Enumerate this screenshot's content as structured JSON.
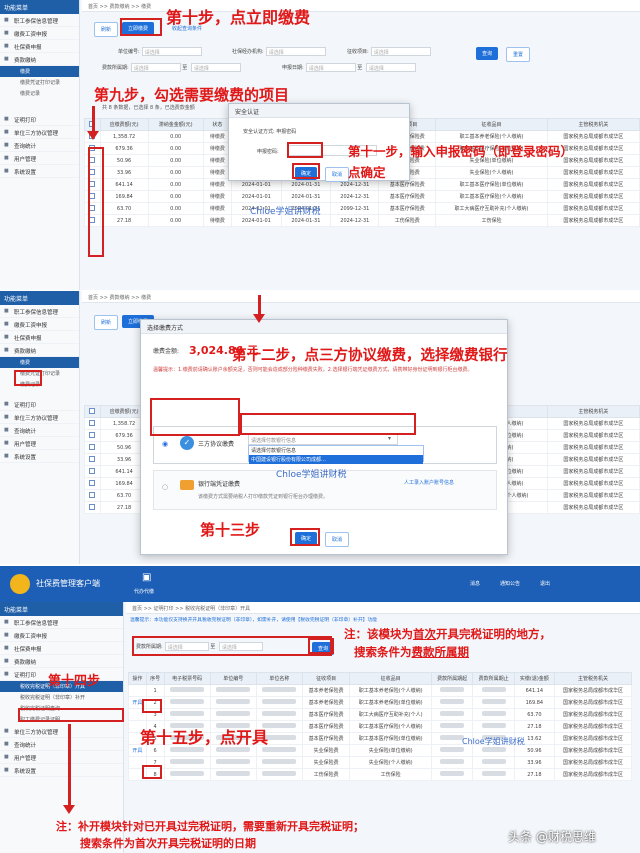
{
  "sidebar": {
    "header": "功能菜单",
    "p1_items": [
      "职工参保信息管理",
      "缴费工资申报",
      "社保费申报",
      "费款缴纳"
    ],
    "p1_sub": [
      "缴费",
      "缴费凭证打印记录",
      "缴费记录"
    ],
    "p1_items2": [
      "证明打印",
      "单位三方协议管理",
      "查询统计",
      "用户管理",
      "系统设置"
    ],
    "p3_sub": [
      "税收完税证明（非印章）开具",
      "税收完税证明（非印章）补开",
      "税收完税证明查询",
      "职工缴费记录证明"
    ]
  },
  "crumb": {
    "p1": "首页 >> 费款缴纳 >> 缴费",
    "p3": "首页 >> 证明打印 >> 税收完税证明（非印章）开具"
  },
  "toolbar": {
    "refresh": "刷新",
    "pay_now": "立即缴费",
    "collect_remind": "收起查询条件",
    "query": "查询",
    "reset": "重置"
  },
  "filters": {
    "unit_no": "单位编号:",
    "agency": "社保经办机构:",
    "collect_item": "征收项目:",
    "period": "费款所属期:",
    "to": "至",
    "pay_date": "申报日期:",
    "placeholder": "请选择"
  },
  "summary": "共 8 条数据，已选择 8 条，已选费款金额",
  "table1": {
    "headers": [
      "",
      "应缴费额(元)",
      "滞纳金金额(元)",
      "状态",
      "费款所属期起",
      "费款所属期止",
      "缴款期限",
      "征收项目",
      "征收品目",
      "主管税务机关"
    ],
    "rows": [
      [
        "1,358.72",
        "0.00",
        "待缴费",
        "2024-01-01",
        "2024-01-31",
        "2024-12-31",
        "基本养老保险费",
        "职工基本养老保险(个人缴纳)",
        "国家税务总局成都市成华区"
      ],
      [
        "679.36",
        "0.00",
        "待缴费",
        "2024-01-01",
        "2024-01-31",
        "2024-12-31",
        "基本医疗保险费",
        "职工基本医疗保险(单位缴纳)",
        "国家税务总局成都市成华区"
      ],
      [
        "50.96",
        "0.00",
        "待缴费",
        "2024-01-01",
        "2024-01-31",
        "2024-12-31",
        "失业保险费",
        "失业保险(单位缴纳)",
        "国家税务总局成都市成华区"
      ],
      [
        "33.96",
        "0.00",
        "待缴费",
        "2024-01-01",
        "2024-01-31",
        "2024-12-31",
        "失业保险费",
        "失业保险(个人缴纳)",
        "国家税务总局成都市成华区"
      ],
      [
        "641.14",
        "0.00",
        "待缴费",
        "2024-01-01",
        "2024-01-31",
        "2024-12-31",
        "基本医疗保险费",
        "职工基本医疗保险(单位缴纳)",
        "国家税务总局成都市成华区"
      ],
      [
        "169.84",
        "0.00",
        "待缴费",
        "2024-01-01",
        "2024-01-31",
        "2024-12-31",
        "基本医疗保险费",
        "职工基本医疗保险(个人缴纳)",
        "国家税务总局成都市成华区"
      ],
      [
        "63.70",
        "0.00",
        "待缴费",
        "2024-01-01",
        "2024-01-31",
        "2099-12-31",
        "基本医疗保险费",
        "职工大病医疗互助补充(个人缴纳)",
        "国家税务总局成都市成华区"
      ],
      [
        "27.18",
        "0.00",
        "待缴费",
        "2024-01-01",
        "2024-01-31",
        "2024-12-31",
        "工伤保险费",
        "工伤保险",
        "国家税务总局成都市成华区"
      ]
    ]
  },
  "dialog1": {
    "title": "安全认证",
    "method_label": "安全认证方式:",
    "method_value": "申报密码",
    "pwd_label": "申报密码:",
    "ok": "确定",
    "cancel": "取消"
  },
  "dialog2": {
    "title": "选择缴费方式",
    "amount_label": "缴费金额:",
    "amount": "3,024.86 元",
    "tip": "温馨提示：1.缴费前请确认账户余额充足，否则可能会造成部分险种缴费失败。2.选择银行端凭证缴费方式，请携带好身份证明到银行柜台缴费。",
    "opt1": "三方协议缴费",
    "bank_ph": "请选择付款银行信息",
    "bank_options": [
      "请选择付款银行信息",
      "中国建设银行股份有限公司成都…"
    ],
    "opt2": "银行端凭证缴费",
    "opt2_desc": "该缴费方式需要纳税人打印缴款凭证到银行柜台办理缴费。",
    "link": "人工录入账户账号信息",
    "ok": "确定",
    "cancel": "取消"
  },
  "app3": {
    "title": "社保费管理客户端",
    "icon_label": "代办代缴",
    "top_items": [
      "消息",
      "通知公告",
      "退出"
    ]
  },
  "p3": {
    "notice": "温馨提示：本功能仅支持换开开具税收完税证明（非印章），如需补开，请使用【税收完税证明（非印章）补开】功能",
    "period_label": "费款所属期:",
    "to": "至",
    "query": "查询",
    "headers": [
      "操作",
      "序号",
      "电子税票号码",
      "单位编号",
      "单位名称",
      "征收项目",
      "征收品目",
      "费款所属期起",
      "费款所属期止",
      "实缴(退)金额",
      "主管税务机关"
    ],
    "rows": [
      [
        "",
        "1",
        "基本养老保险费",
        "职工基本养老保险(个人缴纳)",
        "641.14"
      ],
      [
        "开具",
        "2",
        "基本养老保险费",
        "职工基本养老保险(单位缴纳)",
        "169.84"
      ],
      [
        "",
        "3",
        "基本医疗保险费",
        "职工大病医疗互助补充(个人)",
        "63.70"
      ],
      [
        "",
        "4",
        "基本医疗保险费",
        "职工基本医疗保险(个人缴纳)",
        "27.18"
      ],
      [
        "",
        "5",
        "基本医疗保险费",
        "职工基本医疗保险(单位缴纳)",
        "13.62"
      ],
      [
        "开具",
        "6",
        "失业保险费",
        "失业保险(单位缴纳)",
        "50.96"
      ],
      [
        "",
        "7",
        "失业保险费",
        "失业保险(个人缴纳)",
        "33.96"
      ],
      [
        "",
        "8",
        "工伤保险费",
        "工伤保险",
        "27.18"
      ]
    ],
    "tax_office": "国家税务总局成都市成华区"
  },
  "annotations": {
    "step10": "第十步，点立即缴费",
    "step9": "第九步，勾选需要缴费的项目",
    "step11": "第十一步，输入申报密码（即登录密码）",
    "step11b": "点确定",
    "step12": "第十二步，点三方协议缴费，选择缴费银行",
    "step13": "第十三步",
    "step14": "第十四步",
    "step15": "第十五步，点开具",
    "note1a": "注：该模块为",
    "note1b": "首次",
    "note1c": "开具完税证明的地方，",
    "note2a": "搜索条件为",
    "note2b": "费款所属期",
    "note3": "注：补开模块针对已开具过完税证明，需要重新开具完税证明；",
    "note4": "搜索条件为首次开具完税证明的日期",
    "watermark": "Chloe学姐讲财税",
    "brand": "头条 @财税思维"
  },
  "colors": {
    "primary": "#1e6fd9",
    "annotation": "#e01818",
    "sidebar_head": "#1f5fa8"
  }
}
